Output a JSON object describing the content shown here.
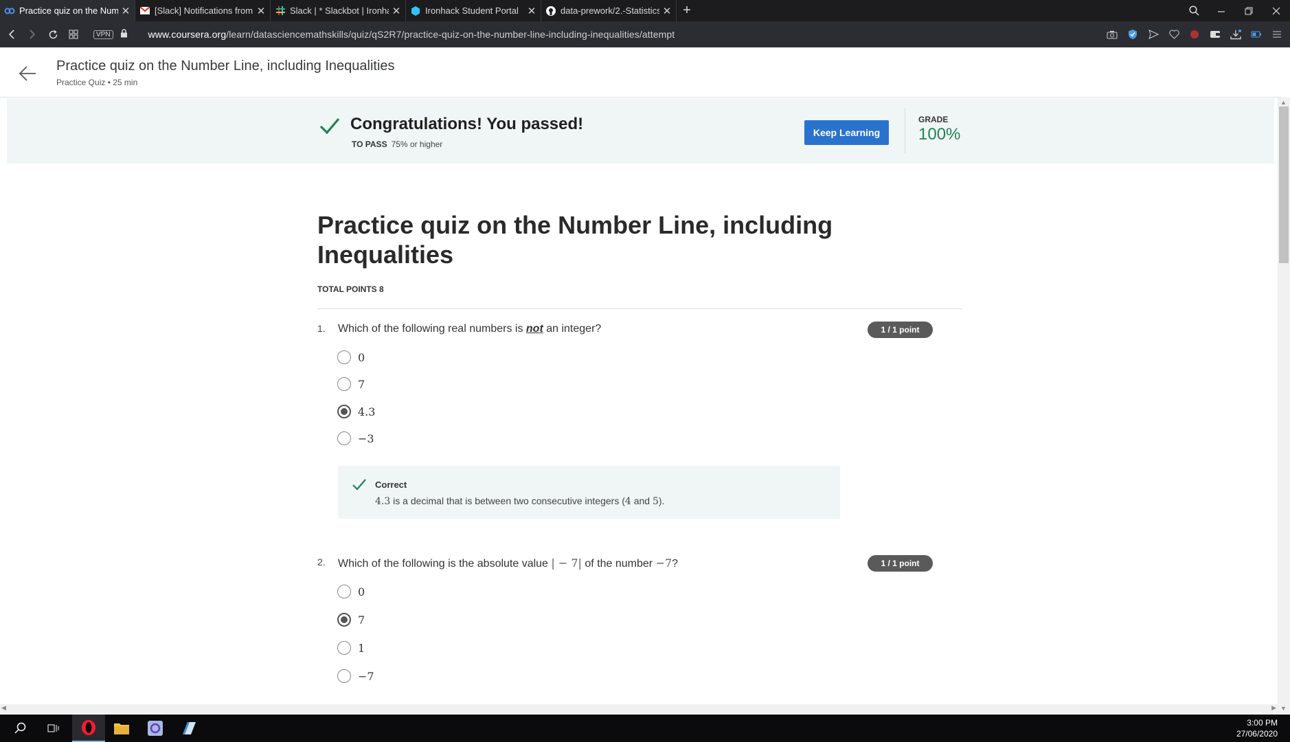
{
  "browser": {
    "tabs": [
      {
        "title": "Practice quiz on the Numb",
        "icon": "coursera-icon",
        "active": true
      },
      {
        "title": "[Slack] Notifications from t",
        "icon": "gmail-icon",
        "active": false
      },
      {
        "title": "Slack | * Slackbot | Ironhack",
        "icon": "slack-icon",
        "active": false
      },
      {
        "title": "Ironhack Student Portal",
        "icon": "ironhack-icon",
        "active": false
      },
      {
        "title": "data-prework/2.-Statistics",
        "icon": "github-icon",
        "active": false
      }
    ],
    "vpn_label": "VPN",
    "url_domain": "www.coursera.org",
    "url_path": "/learn/datasciencemathskills/quiz/qS2R7/practice-quiz-on-the-number-line-including-inequalities/attempt"
  },
  "header": {
    "title": "Practice quiz on the Number Line, including Inequalities",
    "subtitle": "Practice Quiz • 25 min"
  },
  "banner": {
    "message": "Congratulations! You passed!",
    "to_pass_label": "TO PASS",
    "to_pass_value": "75% or higher",
    "button_label": "Keep Learning",
    "grade_label": "GRADE",
    "grade_value": "100%",
    "accent_color": "#1f8354",
    "button_color": "#2a73cc"
  },
  "quiz": {
    "title": "Practice quiz on the Number Line, including Inequalities",
    "total_points": "TOTAL POINTS 8",
    "questions": [
      {
        "number": "1.",
        "text_before": "Which of the following real numbers is ",
        "text_emph": "not",
        "text_after": " an integer?",
        "points": "1 / 1 point",
        "options": [
          "0",
          "7",
          "4.3",
          "−3"
        ],
        "selected": "4.3",
        "feedback_title": "Correct",
        "feedback": {
          "v1": "4.3",
          "t1": " is a decimal that is between two consecutive integers (",
          "v2": "4",
          "t2": " and ",
          "v3": "5",
          "t3": ")."
        }
      },
      {
        "number": "2.",
        "text_before": "Which of the following is the absolute value ",
        "math1": "| − 7|",
        "text_mid": " of the number ",
        "math2": "−7",
        "text_after": "?",
        "points": "1 / 1 point",
        "options": [
          "0",
          "7",
          "1",
          "−7"
        ],
        "selected": "7"
      }
    ]
  },
  "taskbar": {
    "time": "3:00 PM",
    "date": "27/06/2020"
  }
}
